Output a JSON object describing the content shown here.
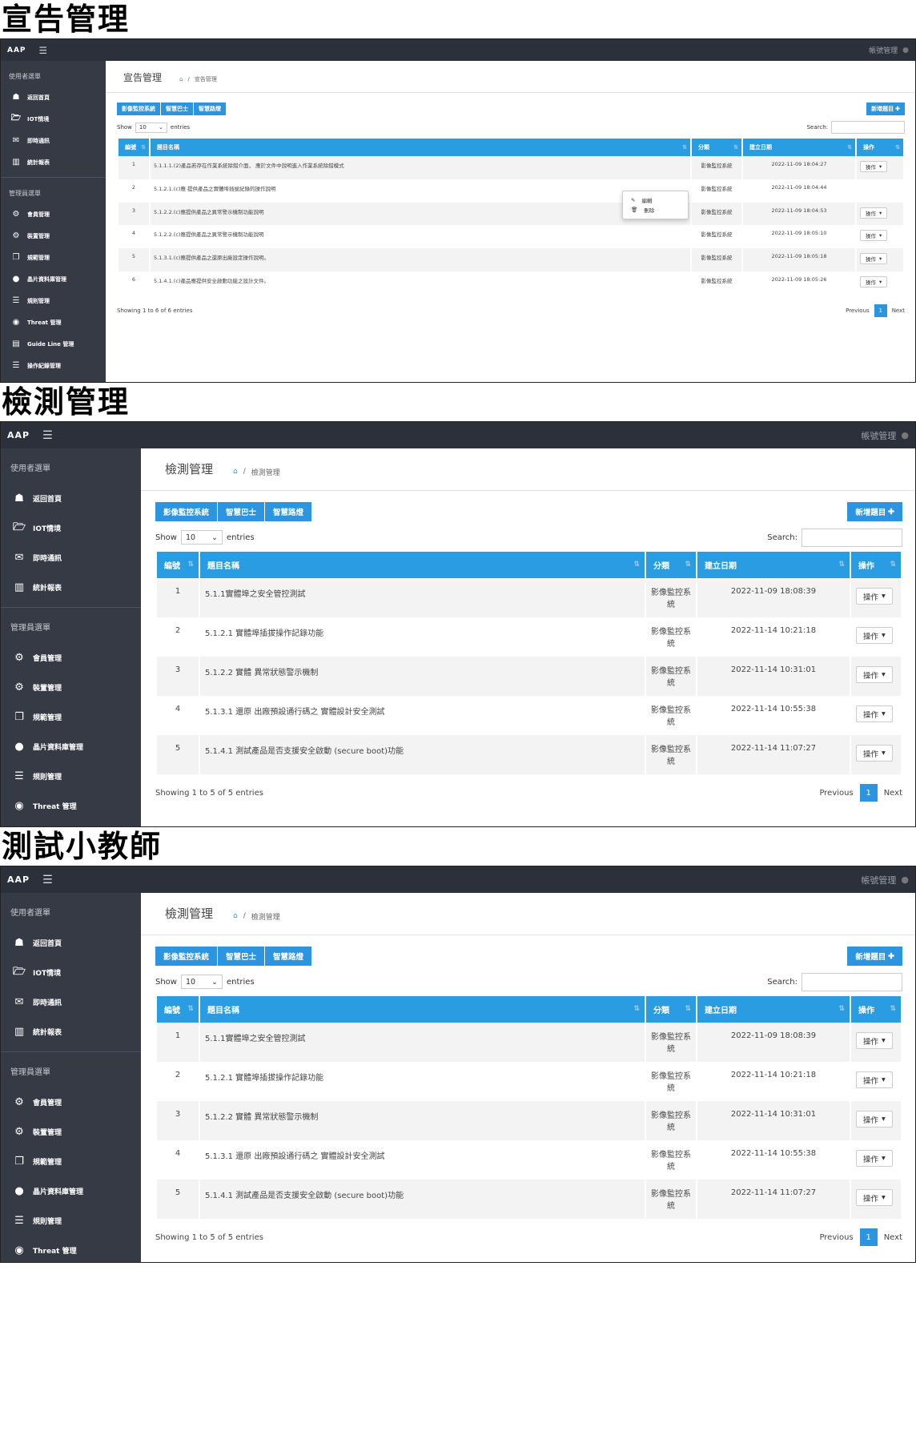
{
  "captions": [
    "宣告管理",
    "檢測管理",
    "測試小教師"
  ],
  "colors": {
    "topbar": "#2b303b",
    "sidebar": "#353a45",
    "accent": "#2d95e0",
    "header": "#2a9de2"
  },
  "topbar": {
    "brand": "AAP",
    "account": "帳號管理"
  },
  "sidebar": {
    "user_section": "使用者選單",
    "user_items": [
      {
        "icon": "home-icon",
        "label": "返回首頁"
      },
      {
        "icon": "folder-icon",
        "label": "IOT情境"
      },
      {
        "icon": "chat-icon",
        "label": "即時通訊"
      },
      {
        "icon": "chart-icon",
        "label": "統計報表"
      }
    ],
    "admin_section": "管理員選單",
    "admin_items": [
      {
        "icon": "gears-icon",
        "label": "會員管理"
      },
      {
        "icon": "gears-icon",
        "label": "裝置管理"
      },
      {
        "icon": "copy-icon",
        "label": "規範管理"
      },
      {
        "icon": "circle-icon",
        "label": "晶片資料庫管理"
      },
      {
        "icon": "list-icon",
        "label": "規則管理"
      },
      {
        "icon": "eye-icon",
        "label": "Threat 管理"
      },
      {
        "icon": "document-icon",
        "label": "Guide Line 管理"
      },
      {
        "icon": "list-icon",
        "label": "操作紀錄管理"
      }
    ]
  },
  "common": {
    "categories": [
      "影像監控系統",
      "智慧巴士",
      "智慧路燈"
    ],
    "add_button": "新增題目",
    "show_label": "Show",
    "entries_select": "10",
    "entries_label": "entries",
    "search_label": "Search:",
    "columns": [
      "編號",
      "題目名稱",
      "分類",
      "建立日期",
      "操作"
    ],
    "op_button": "操作",
    "previous": "Previous",
    "current_page": "1",
    "next": "Next"
  },
  "panel1": {
    "page_title": "宣告管理",
    "breadcrumb": "宣告管理",
    "rows": [
      {
        "no": "1",
        "name": "5.1.1.1.(2)產品若存在作業系統除錯介面， 應於文件中說明進入作業系統除錯模式",
        "cat": "影像監控系統",
        "date": "2022-11-09 18:04:27"
      },
      {
        "no": "2",
        "name": "5.1.2.1.(c)應 提供產品之實體埠插拔紀錄的操作說明",
        "cat": "影像監控系統",
        "date": "2022-11-09 18:04:44"
      },
      {
        "no": "3",
        "name": "5.1.2.2.(c)應提供產品之異常警示機制功能說明",
        "cat": "影像監控系統",
        "date": "2022-11-09 18:04:53"
      },
      {
        "no": "4",
        "name": "5.1.2.2.(c)應提供產品之異常警示機制功能說明",
        "cat": "影像監控系統",
        "date": "2022-11-09 18:05:10"
      },
      {
        "no": "5",
        "name": "5.1.3.1.(c)應提供產品之還原出廠設定操作說明。",
        "cat": "影像監控系統",
        "date": "2022-11-09 18:05:18"
      },
      {
        "no": "6",
        "name": "5.1.4.1.(c)產品應提供安全啟動功能之設計文件。",
        "cat": "影像監控系統",
        "date": "2022-11-09 18:05:26"
      }
    ],
    "showing": "Showing 1 to 6 of 6 entries",
    "dropdown": {
      "edit": "編輯",
      "delete": "刪除"
    }
  },
  "panel2": {
    "page_title": "檢測管理",
    "breadcrumb": "檢測管理",
    "rows": [
      {
        "no": "1",
        "name": "5.1.1實體埠之安全管控測試",
        "cat": "影像監控系統",
        "date": "2022-11-09 18:08:39"
      },
      {
        "no": "2",
        "name": "5.1.2.1 實體埠插拔操作記錄功能",
        "cat": "影像監控系統",
        "date": "2022-11-14 10:21:18"
      },
      {
        "no": "3",
        "name": "5.1.2.2 實體 異常狀態警示機制",
        "cat": "影像監控系統",
        "date": "2022-11-14 10:31:01"
      },
      {
        "no": "4",
        "name": "5.1.3.1 還原 出廠預設通行碼之 實體設計安全測試",
        "cat": "影像監控系統",
        "date": "2022-11-14 10:55:38"
      },
      {
        "no": "5",
        "name": "5.1.4.1 測試產品是否支援安全啟動 (secure boot)功能",
        "cat": "影像監控系統",
        "date": "2022-11-14 11:07:27"
      }
    ],
    "showing": "Showing 1 to 5 of 5 entries"
  },
  "panel3": {
    "page_title": "檢測管理",
    "breadcrumb": "檢測管理",
    "rows": [
      {
        "no": "1",
        "name": "5.1.1實體埠之安全管控測試",
        "cat": "影像監控系統",
        "date": "2022-11-09 18:08:39"
      },
      {
        "no": "2",
        "name": "5.1.2.1 實體埠插拔操作記錄功能",
        "cat": "影像監控系統",
        "date": "2022-11-14 10:21:18"
      },
      {
        "no": "3",
        "name": "5.1.2.2 實體 異常狀態警示機制",
        "cat": "影像監控系統",
        "date": "2022-11-14 10:31:01"
      },
      {
        "no": "4",
        "name": "5.1.3.1 還原 出廠預設通行碼之 實體設計安全測試",
        "cat": "影像監控系統",
        "date": "2022-11-14 10:55:38"
      },
      {
        "no": "5",
        "name": "5.1.4.1 測試產品是否支援安全啟動 (secure boot)功能",
        "cat": "影像監控系統",
        "date": "2022-11-14 11:07:27"
      }
    ],
    "showing": "Showing 1 to 5 of 5 entries"
  }
}
